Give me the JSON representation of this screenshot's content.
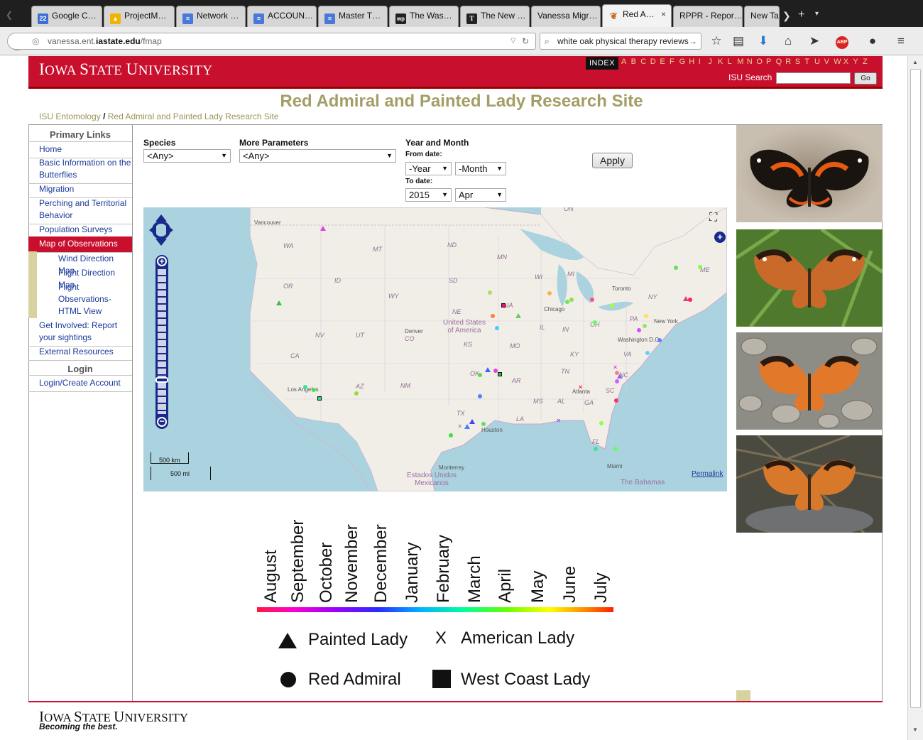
{
  "browser": {
    "tabs": [
      {
        "label": "Google C…",
        "icon": "calendar-icon",
        "icon_text": "22",
        "color": "#3b6fd4"
      },
      {
        "label": "ProjectM…",
        "icon": "drive-icon",
        "icon_text": "▲",
        "color": "#f2b400"
      },
      {
        "label": "Network …",
        "icon": "docs-icon",
        "icon_text": "≡",
        "color": "#4a78d8"
      },
      {
        "label": "ACCOUN…",
        "icon": "docs-icon",
        "icon_text": "≡",
        "color": "#4a78d8"
      },
      {
        "label": "Master T…",
        "icon": "docs-icon",
        "icon_text": "≡",
        "color": "#4a78d8"
      },
      {
        "label": "The Was…",
        "icon": "wapo-icon",
        "icon_text": "wp",
        "color": "#222222"
      },
      {
        "label": "The New …",
        "icon": "nyt-icon",
        "icon_text": "T",
        "color": "#222222"
      },
      {
        "label": "Vanessa Migr…",
        "icon": "",
        "icon_text": "",
        "color": ""
      },
      {
        "label": "Red A…",
        "icon": "butterfly-icon",
        "icon_text": "❦",
        "color": "#c86a20"
      },
      {
        "label": "RPPR - Repor…",
        "icon": "",
        "icon_text": "",
        "color": ""
      },
      {
        "label": "New Ta",
        "icon": "",
        "icon_text": "",
        "color": ""
      }
    ],
    "active_tab_close": "×",
    "url_host_prefix": "vanessa.ent.",
    "url_host_bold": "iastate.edu",
    "url_path": "/fmap",
    "search_value": "white oak physical therapy reviews"
  },
  "header": {
    "logo_first": "I",
    "logo_rest1": "OWA ",
    "logo_s": "S",
    "logo_rest2": "TATE ",
    "logo_u": "U",
    "logo_rest3": "NIVERSITY",
    "index_label": "INDEX",
    "letters": [
      "A",
      "B",
      "C",
      "D",
      "E",
      "F",
      "G",
      "H",
      "I",
      "J",
      "K",
      "L",
      "M",
      "N",
      "O",
      "P",
      "Q",
      "R",
      "S",
      "T",
      "U",
      "V",
      "W",
      "X",
      "Y",
      "Z"
    ],
    "search_label": "ISU Search",
    "go_label": "Go"
  },
  "site_title": "Red Admiral and Painted Lady Research Site",
  "breadcrumb": {
    "root": "ISU Entomology",
    "sep": "/",
    "current": "Red Admiral and Painted Lady Research Site"
  },
  "sidebar": {
    "primary_heading": "Primary Links",
    "items": [
      {
        "label": "Home"
      },
      {
        "label": "Basic Information on the Butterflies"
      },
      {
        "label": "Migration"
      },
      {
        "label": "Perching and Territorial Behavior"
      },
      {
        "label": "Population Surveys"
      },
      {
        "label": "Map of Observations"
      }
    ],
    "subitems": [
      {
        "label": "Wind Direction Map"
      },
      {
        "label": "Flight Direction Map"
      },
      {
        "label": "Flight Observations-HTML View"
      }
    ],
    "items2": [
      {
        "label": "Get Involved: Report your sightings"
      },
      {
        "label": "External Resources"
      }
    ],
    "login_heading": "Login",
    "login_item": "Login/Create Account"
  },
  "form": {
    "species_label": "Species",
    "species_value": "<Any>",
    "params_label": "More Parameters",
    "params_value": "<Any>",
    "year_month_label": "Year and Month",
    "from_label": "From date:",
    "from_year": "-Year",
    "from_month": "-Month",
    "to_label": "To date:",
    "to_year": "2015",
    "to_month": "Apr",
    "apply_label": "Apply"
  },
  "map": {
    "scale_km": "500 km",
    "scale_mi": "500 mi",
    "permalink": "Permalink",
    "region_labels": [
      "WA",
      "MT",
      "ND",
      "MN",
      "OR",
      "ID",
      "SD",
      "WI",
      "MI",
      "WY",
      "NE",
      "IA",
      "NY",
      "PA",
      "NV",
      "UT",
      "CO",
      "KS",
      "MO",
      "IL",
      "IN",
      "OH",
      "CA",
      "OK",
      "AR",
      "KY",
      "VA",
      "NC",
      "TN",
      "SC",
      "AZ",
      "NM",
      "MS",
      "AL",
      "GA",
      "TX",
      "LA",
      "FL",
      "ME",
      "ON"
    ],
    "city_labels": [
      "Vancouver",
      "Toronto",
      "Chicago",
      "New York",
      "Washington D.C.",
      "Denver",
      "Los Angeles",
      "Houston",
      "Atlanta",
      "Miami",
      "Monterrey"
    ],
    "country_labels": [
      "United States of America",
      "Estados Unidos Mexicanos",
      "The Bahamas"
    ]
  },
  "legend": {
    "months": [
      "August",
      "September",
      "October",
      "November",
      "December",
      "January",
      "February",
      "March",
      "April",
      "May",
      "June",
      "July"
    ],
    "species": [
      {
        "symbol": "▲",
        "name": "Painted Lady"
      },
      {
        "symbol": "X",
        "name": "American Lady"
      },
      {
        "symbol": "●",
        "name": "Red Admiral"
      },
      {
        "symbol": "■",
        "name": "West Coast Lady"
      }
    ]
  },
  "footer": {
    "logo_first": "I",
    "logo_rest1": "OWA ",
    "logo_s": "S",
    "logo_rest2": "TATE ",
    "logo_u": "U",
    "logo_rest3": "NIVERSITY",
    "tagline": "Becoming the best."
  }
}
